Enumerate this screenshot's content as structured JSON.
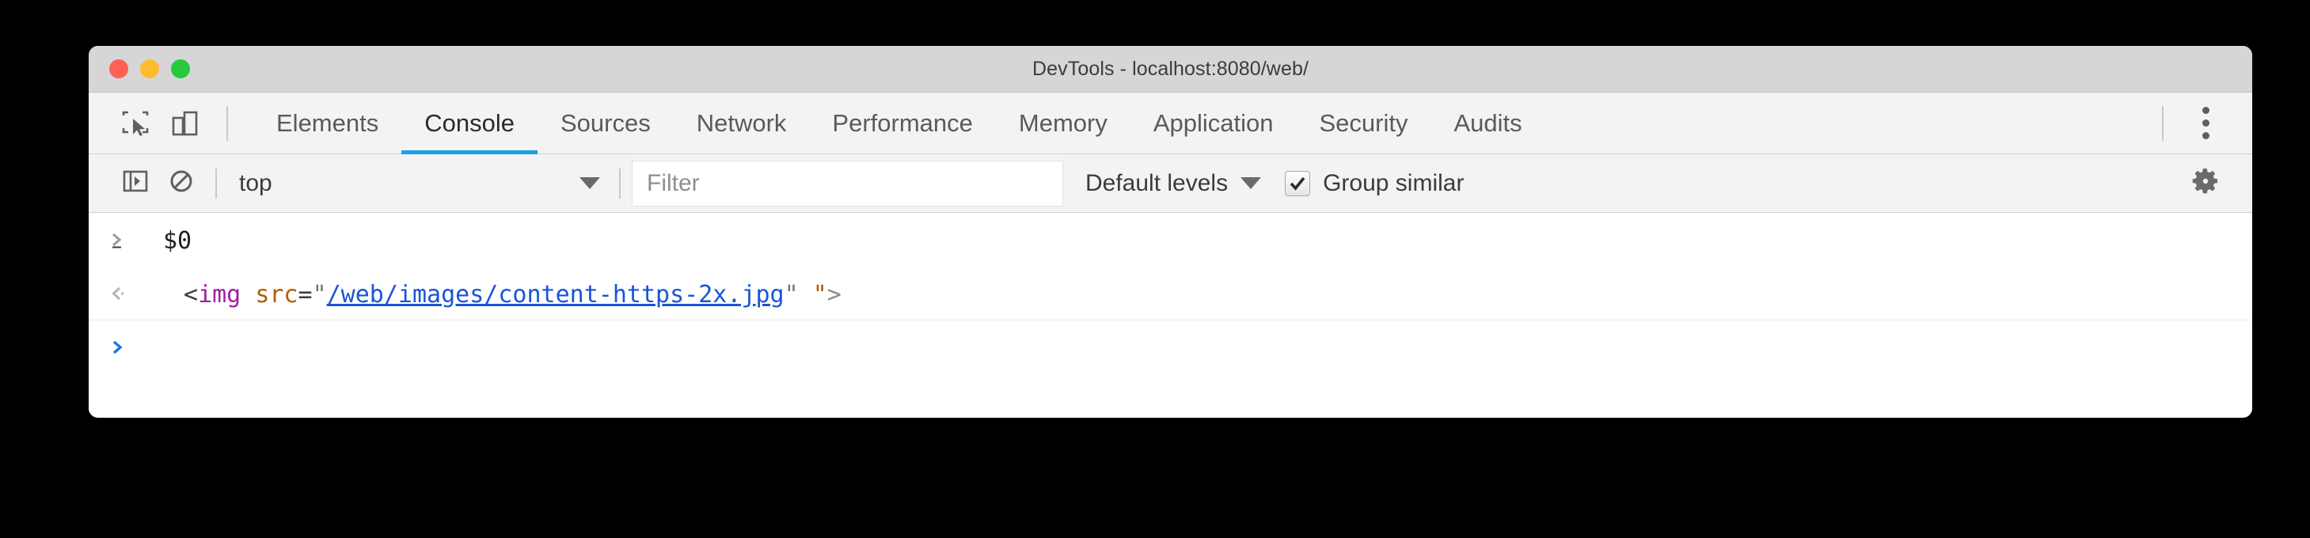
{
  "window": {
    "title": "DevTools - localhost:8080/web/",
    "traffic_lights": [
      {
        "name": "close",
        "color": "#ff5f56"
      },
      {
        "name": "minimize",
        "color": "#fdbc2e"
      },
      {
        "name": "zoom",
        "color": "#28c83f"
      }
    ]
  },
  "tabbar": {
    "inspect_icon": "inspect-element-icon",
    "device_icon": "device-toolbar-icon",
    "menu_icon": "more-options-icon",
    "tabs": [
      {
        "label": "Elements",
        "active": false
      },
      {
        "label": "Console",
        "active": true
      },
      {
        "label": "Sources",
        "active": false
      },
      {
        "label": "Network",
        "active": false
      },
      {
        "label": "Performance",
        "active": false
      },
      {
        "label": "Memory",
        "active": false
      },
      {
        "label": "Application",
        "active": false
      },
      {
        "label": "Security",
        "active": false
      },
      {
        "label": "Audits",
        "active": false
      }
    ],
    "active_underline_color": "#18a0e8"
  },
  "console_toolbar": {
    "sidebar_toggle_icon": "console-sidebar-icon",
    "clear_icon": "clear-console-icon",
    "context_value": "top",
    "context_caret": "chevron-down-icon",
    "filter_placeholder": "Filter",
    "filter_value": "",
    "levels_label": "Default levels",
    "levels_caret": "chevron-down-icon",
    "group_similar_label": "Group similar",
    "group_similar_checked": true,
    "settings_icon": "gear-icon"
  },
  "console": {
    "rows": [
      {
        "type": "input",
        "gutter_icon": "input-prompt-icon",
        "text": "$0"
      },
      {
        "type": "output",
        "gutter_icon": "output-result-icon",
        "tokens": {
          "open": "<",
          "tag": "img",
          "space": " ",
          "attr": "src",
          "equals": "=",
          "quote_open": "\"",
          "url": "/web/images/content-https-2x.jpg",
          "quote_close": "\"",
          "gap": " ",
          "quote_stray": "\"",
          "close": ">"
        }
      },
      {
        "type": "prompt",
        "gutter_icon": "active-prompt-icon",
        "text": ""
      }
    ]
  },
  "colors": {
    "background": "#000000",
    "titlebar": "#d6d6d6",
    "toolbar": "#f3f3f3",
    "accent": "#18a0e8",
    "link": "#1a54d8",
    "tag": "#a020a0",
    "attribute": "#b35c00"
  }
}
